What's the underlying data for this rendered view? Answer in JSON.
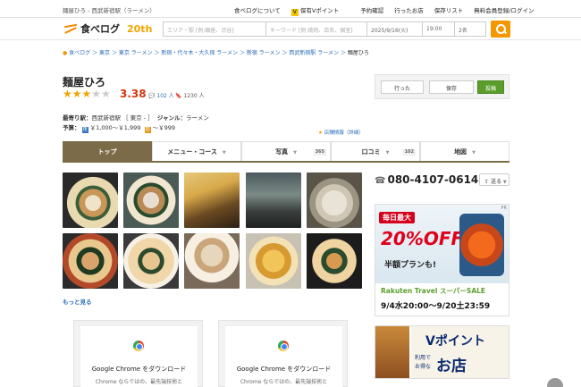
{
  "topbar": {
    "breadcrumb": "麺屋ひろ - 西武新宿駅（ラーメン）",
    "links": [
      "食べログについて",
      "保有Vポイント",
      "予約確認",
      "行ったお店",
      "保存リスト",
      "無料会員登録/ログイン"
    ],
    "v_mark": "V"
  },
  "header": {
    "logo_text": "食べログ",
    "anniversary": "20th",
    "search_area_placeholder": "エリア・駅 [例:銀座、渋谷]",
    "search_keyword_placeholder": "キーワード [例:焼肉、店名、個室]",
    "date": "2025/9/16(火)",
    "time": "19:00",
    "people": "2名"
  },
  "breadcrumb": {
    "items": [
      "食べログ",
      "東京",
      "東京 ラーメン",
      "新宿・代々木・大久保 ラーメン",
      "新宿 ラーメン",
      "西武新宿駅 ラーメン"
    ],
    "current": "麺屋ひろ"
  },
  "restaurant": {
    "name": "麺屋ひろ",
    "rating": "3.38",
    "stars_filled": 3,
    "stars_total": 5,
    "reviews": "102 人",
    "saves": "1230 人",
    "station_label": "最寄り駅：",
    "station": "西武新宿駅",
    "area": "［ 東京 - ］",
    "genre_label": "ジャンル：",
    "genre": "ラーメン",
    "budget_label": "予算：",
    "budget_dinner_tag": "夜",
    "budget_dinner": "￥1,000～￥1,999",
    "budget_lunch_tag": "昼",
    "budget_lunch": "～￥999",
    "map_info": "店舗情報（詳細）"
  },
  "actions": {
    "went": "行った",
    "save": "保存",
    "reserve": "投稿"
  },
  "tabs": [
    {
      "label": "トップ",
      "count": ""
    },
    {
      "label": "メニュー・コース",
      "count": ""
    },
    {
      "label": "写真",
      "count": "365"
    },
    {
      "label": "口コミ",
      "count": "102"
    },
    {
      "label": "地図",
      "count": ""
    }
  ],
  "photos": {
    "more": "もっと見る"
  },
  "side": {
    "phone": "080-4107-0614",
    "send": "送る",
    "ad1_lines": [
      "毎日最大",
      "20%OFF",
      "半額プランも!",
      "Rakuten Travel スーパーSALE",
      "9/4水20:00～9/20土23:59"
    ],
    "ad1_badge": "PR",
    "ad2_lines": [
      "Vポイント",
      "利用で",
      "お得な",
      "お店"
    ]
  },
  "google_ads": [
    {
      "title": "Google Chrome をダウンロード",
      "sub": "Chrome ならではの、最先端技術と"
    },
    {
      "title": "Google Chrome をダウンロード",
      "sub": "Chrome ならではの、最先端技術と"
    }
  ]
}
